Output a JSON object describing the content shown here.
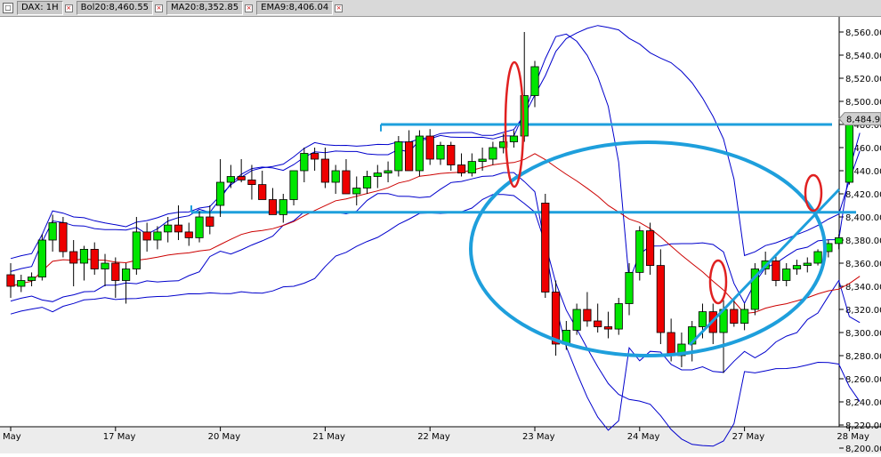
{
  "toolbar": {
    "icon": "window-menu-icon",
    "symbol_label": "DAX: 1H",
    "bollinger_label": "Bol20:8,460.55",
    "ma_label": "MA20:8,352.85",
    "ema_label": "EMA9:8,406.04",
    "close_icon": "close-x-icon"
  },
  "colors": {
    "up": "#00e600",
    "down": "#ee0000",
    "bollinger": "#0000cc",
    "ma": "#cc0000",
    "annotation": "#1e9fdc",
    "marker": "#e02020"
  },
  "chart_data": {
    "type": "candlestick",
    "price_label": "8,484.91",
    "ylim": [
      8180,
      8580
    ],
    "y_ticks": [
      "8,560.00",
      "8,540.00",
      "8,520.00",
      "8,500.00",
      "8,480.00",
      "8,460.00",
      "8,440.00",
      "8,420.00",
      "8,400.00",
      "8,380.00",
      "8,360.00",
      "8,340.00",
      "8,320.00",
      "8,300.00",
      "8,280.00",
      "8,260.00",
      "8,240.00",
      "8,220.00",
      "8,200.00"
    ],
    "x_labels": [
      {
        "label": "May",
        "bar": 0
      },
      {
        "label": "17 May",
        "bar": 10
      },
      {
        "label": "20 May",
        "bar": 20
      },
      {
        "label": "21 May",
        "bar": 30
      },
      {
        "label": "22 May",
        "bar": 40
      },
      {
        "label": "23 May",
        "bar": 50
      },
      {
        "label": "24 May",
        "bar": 60
      },
      {
        "label": "27 May",
        "bar": 70
      },
      {
        "label": "28 May",
        "bar": 80
      }
    ],
    "candles": [
      [
        8350,
        8360,
        8330,
        8340
      ],
      [
        8340,
        8350,
        8335,
        8345
      ],
      [
        8345,
        8352,
        8340,
        8348
      ],
      [
        8348,
        8385,
        8345,
        8380
      ],
      [
        8380,
        8402,
        8370,
        8395
      ],
      [
        8395,
        8400,
        8365,
        8370
      ],
      [
        8370,
        8380,
        8340,
        8360
      ],
      [
        8360,
        8375,
        8345,
        8372
      ],
      [
        8372,
        8378,
        8350,
        8355
      ],
      [
        8355,
        8368,
        8340,
        8360
      ],
      [
        8360,
        8365,
        8330,
        8345
      ],
      [
        8345,
        8360,
        8325,
        8355
      ],
      [
        8355,
        8400,
        8350,
        8387
      ],
      [
        8387,
        8395,
        8370,
        8380
      ],
      [
        8380,
        8392,
        8372,
        8387
      ],
      [
        8387,
        8400,
        8378,
        8393
      ],
      [
        8393,
        8410,
        8380,
        8387
      ],
      [
        8387,
        8395,
        8375,
        8382
      ],
      [
        8382,
        8405,
        8378,
        8400
      ],
      [
        8400,
        8410,
        8385,
        8392
      ],
      [
        8410,
        8450,
        8400,
        8430
      ],
      [
        8430,
        8445,
        8425,
        8435
      ],
      [
        8435,
        8450,
        8430,
        8432
      ],
      [
        8432,
        8445,
        8415,
        8428
      ],
      [
        8428,
        8440,
        8420,
        8415
      ],
      [
        8415,
        8425,
        8405,
        8402
      ],
      [
        8402,
        8420,
        8395,
        8415
      ],
      [
        8415,
        8440,
        8410,
        8440
      ],
      [
        8440,
        8460,
        8430,
        8455
      ],
      [
        8455,
        8460,
        8440,
        8450
      ],
      [
        8450,
        8460,
        8425,
        8430
      ],
      [
        8430,
        8445,
        8420,
        8440
      ],
      [
        8440,
        8450,
        8425,
        8420
      ],
      [
        8420,
        8435,
        8410,
        8425
      ],
      [
        8425,
        8440,
        8420,
        8435
      ],
      [
        8435,
        8445,
        8425,
        8438
      ],
      [
        8438,
        8448,
        8430,
        8440
      ],
      [
        8440,
        8470,
        8435,
        8465
      ],
      [
        8465,
        8475,
        8440,
        8440
      ],
      [
        8440,
        8475,
        8435,
        8470
      ],
      [
        8470,
        8476,
        8445,
        8450
      ],
      [
        8450,
        8465,
        8445,
        8462
      ],
      [
        8462,
        8465,
        8440,
        8445
      ],
      [
        8445,
        8455,
        8435,
        8438
      ],
      [
        8438,
        8455,
        8435,
        8448
      ],
      [
        8448,
        8460,
        8440,
        8450
      ],
      [
        8450,
        8465,
        8445,
        8460
      ],
      [
        8460,
        8472,
        8455,
        8465
      ],
      [
        8465,
        8475,
        8460,
        8470
      ],
      [
        8470,
        8560,
        8465,
        8505
      ],
      [
        8505,
        8535,
        8495,
        8530
      ],
      [
        8412,
        8420,
        8330,
        8335
      ],
      [
        8335,
        8345,
        8280,
        8290
      ],
      [
        8290,
        8310,
        8285,
        8302
      ],
      [
        8302,
        8325,
        8298,
        8320
      ],
      [
        8320,
        8335,
        8305,
        8310
      ],
      [
        8310,
        8325,
        8300,
        8305
      ],
      [
        8305,
        8318,
        8295,
        8303
      ],
      [
        8303,
        8330,
        8298,
        8325
      ],
      [
        8325,
        8360,
        8315,
        8352
      ],
      [
        8352,
        8392,
        8345,
        8388
      ],
      [
        8388,
        8395,
        8350,
        8358
      ],
      [
        8358,
        8372,
        8290,
        8300
      ],
      [
        8300,
        8312,
        8275,
        8280
      ],
      [
        8280,
        8300,
        8270,
        8290
      ],
      [
        8290,
        8310,
        8275,
        8305
      ],
      [
        8305,
        8325,
        8295,
        8318
      ],
      [
        8318,
        8325,
        8290,
        8300
      ],
      [
        8300,
        8328,
        8265,
        8320
      ],
      [
        8320,
        8330,
        8305,
        8308
      ],
      [
        8308,
        8325,
        8302,
        8320
      ],
      [
        8320,
        8360,
        8315,
        8355
      ],
      [
        8355,
        8370,
        8350,
        8362
      ],
      [
        8362,
        8368,
        8340,
        8345
      ],
      [
        8345,
        8360,
        8340,
        8355
      ],
      [
        8355,
        8363,
        8350,
        8358
      ],
      [
        8358,
        8365,
        8352,
        8360
      ],
      [
        8360,
        8372,
        8358,
        8370
      ],
      [
        8370,
        8380,
        8365,
        8377
      ],
      [
        8377,
        8385,
        8372,
        8382
      ],
      [
        8430,
        8488,
        8428,
        8485
      ],
      [
        8485,
        8490,
        8480,
        8484
      ]
    ]
  }
}
